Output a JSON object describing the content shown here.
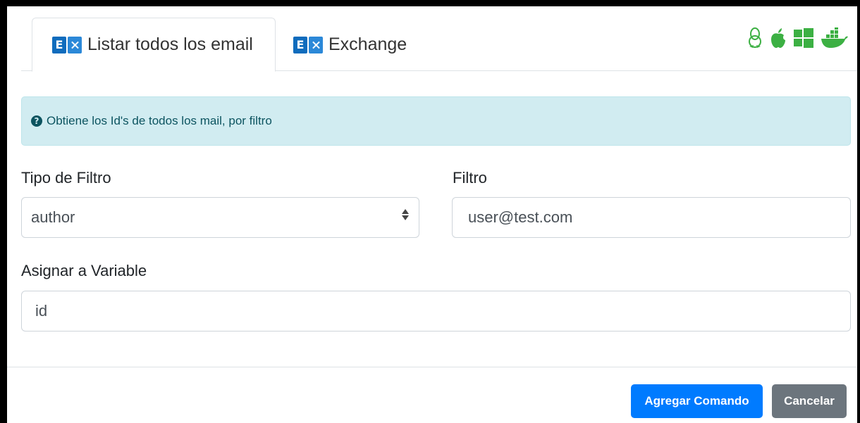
{
  "tabs": [
    {
      "label": "Listar todos los email",
      "active": true,
      "icon": "exchange-icon"
    },
    {
      "label": "Exchange",
      "active": false,
      "icon": "exchange-icon"
    }
  ],
  "os_icons": [
    "linux-icon",
    "apple-icon",
    "windows-icon",
    "docker-icon"
  ],
  "colors": {
    "os_icon": "#3cb043",
    "primary": "#007bff",
    "secondary": "#6c757d",
    "alert_bg": "#d1ecf1",
    "alert_text": "#0c5460"
  },
  "alert": {
    "text": "Obtiene los Id's de todos los mail, por filtro",
    "icon": "question-circle-icon"
  },
  "form": {
    "filter_type": {
      "label": "Tipo de Filtro",
      "value": "author"
    },
    "filter": {
      "label": "Filtro",
      "value": "user@test.com"
    },
    "variable": {
      "label": "Asignar a Variable",
      "value": "id"
    }
  },
  "buttons": {
    "add": "Agregar Comando",
    "cancel": "Cancelar"
  }
}
